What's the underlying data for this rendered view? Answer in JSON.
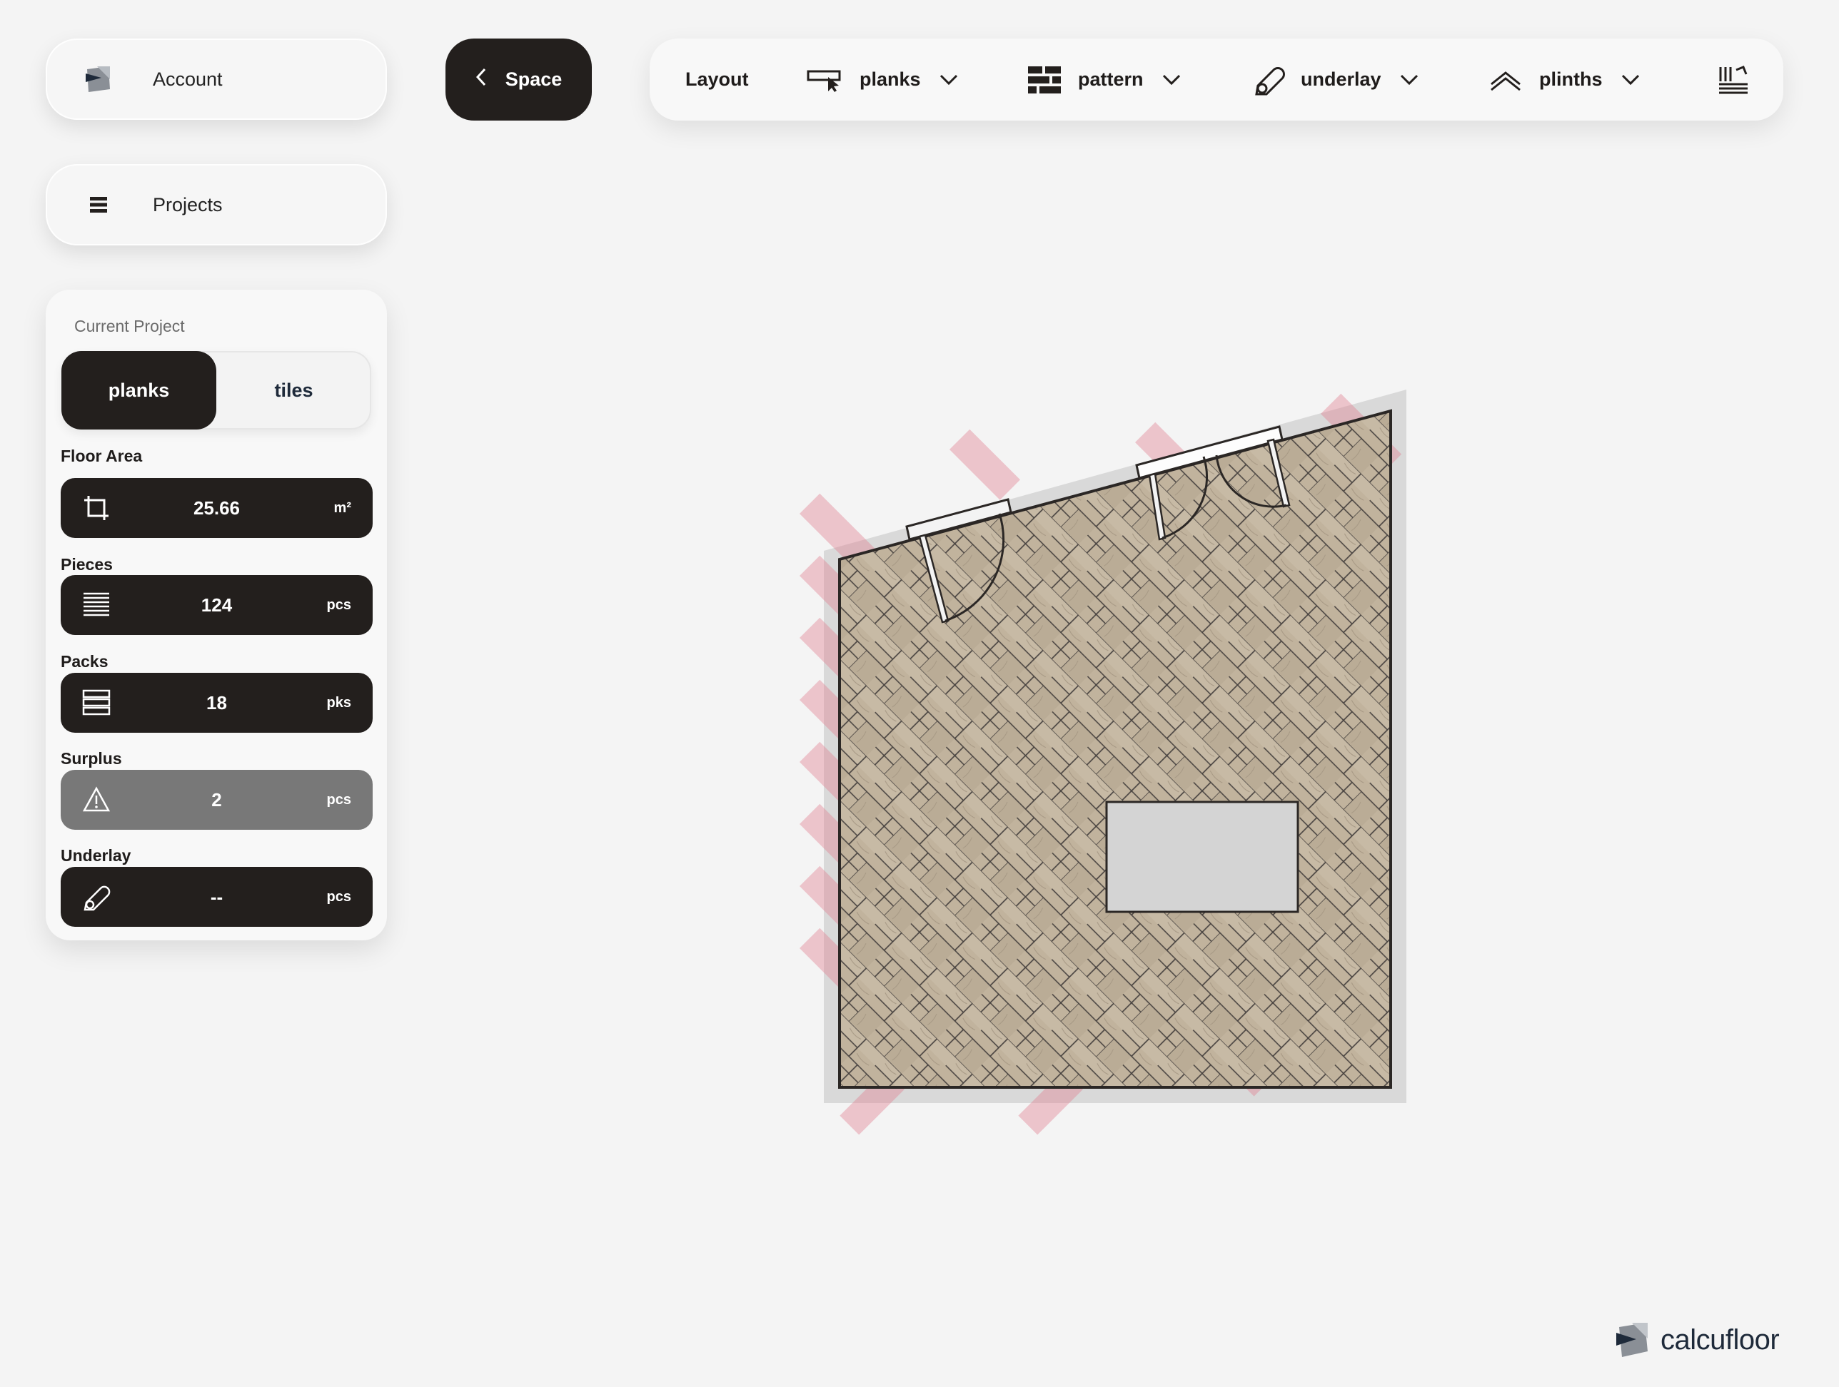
{
  "nav": {
    "account_label": "Account",
    "projects_label": "Projects",
    "space_label": "Space"
  },
  "toolbar": {
    "layout_label": "Layout",
    "planks_label": "planks",
    "pattern_label": "pattern",
    "underlay_label": "underlay",
    "plinths_label": "plinths"
  },
  "project": {
    "title": "Current Project",
    "modes": [
      "planks",
      "tiles"
    ],
    "selected_mode": "planks",
    "floor_area": {
      "label": "Floor Area",
      "value": "25.66",
      "unit": "m²"
    },
    "pieces": {
      "label": "Pieces",
      "value": "124",
      "unit": "pcs"
    },
    "packs": {
      "label": "Packs",
      "value": "18",
      "unit": "pks"
    },
    "surplus": {
      "label": "Surplus",
      "value": "2",
      "unit": "pcs"
    },
    "underlay": {
      "label": "Underlay",
      "value": "--",
      "unit": "pcs"
    }
  },
  "brand": {
    "name": "calcufloor"
  },
  "colors": {
    "dark": "#231f1d",
    "surplus": "#787878",
    "wall": "#2b2725",
    "overflow_marker": "#e07d90",
    "obstacle": "#d4d4d4",
    "wood_light": "#c9b79f",
    "wood_gray": "#b9b4b0"
  },
  "icons": {
    "account": "logo-icon",
    "projects": "menu-icon",
    "space_back": "chevron-left-icon",
    "planks": "plank-icon",
    "pattern": "brick-pattern-icon",
    "underlay": "roll-icon",
    "plinths": "plinth-icon",
    "cut_list": "cut-list-icon",
    "floor_area": "area-crop-icon",
    "pieces": "lines-icon",
    "packs": "stack-icon",
    "surplus": "warning-icon",
    "underlay_stat": "roll-icon"
  }
}
